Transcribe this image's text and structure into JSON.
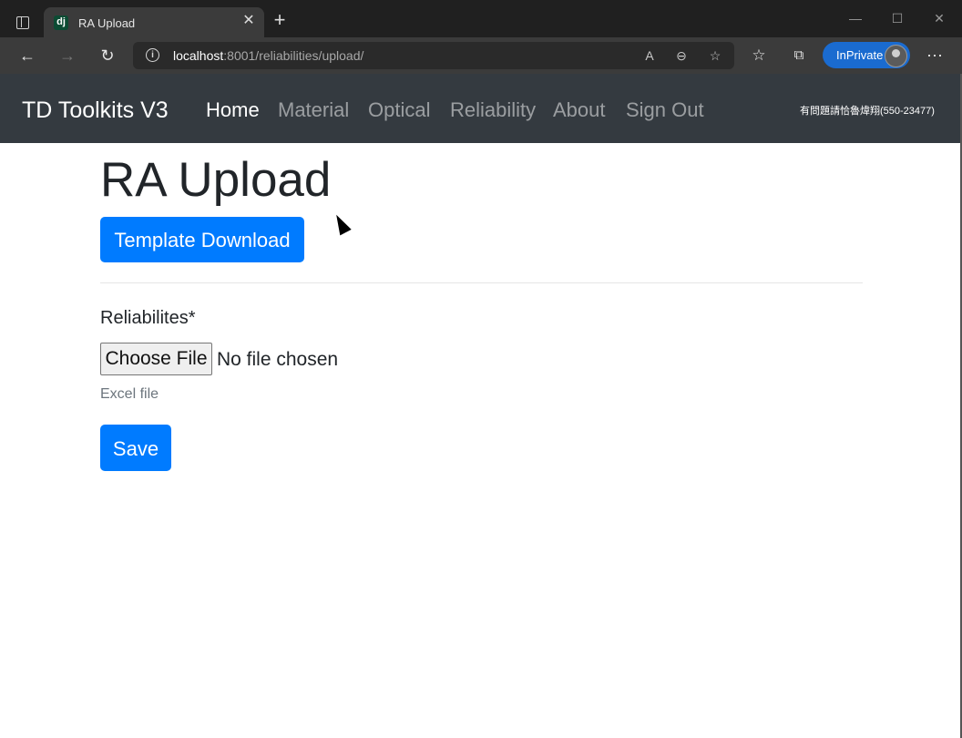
{
  "browser": {
    "tab_title": "RA Upload",
    "favicon_text": "dj",
    "url_host": "localhost",
    "url_rest": ":8001/reliabilities/upload/",
    "inprivate_label": "InPrivate"
  },
  "navbar": {
    "brand": "TD Toolkits V3",
    "links": [
      "Home",
      "Material",
      "Optical",
      "Reliability",
      "About",
      "Sign Out"
    ],
    "active": "Home",
    "note": "有問題請恰魯煒翔(550-23477)",
    "bg_color": "#343a40"
  },
  "page": {
    "title": "RA Upload",
    "template_button": "Template Download",
    "field_label": "Reliabilites*",
    "choose_file_button": "Choose File",
    "file_status": "No file chosen",
    "help_text": "Excel file",
    "save_button": "Save",
    "primary_color": "#007bff"
  }
}
